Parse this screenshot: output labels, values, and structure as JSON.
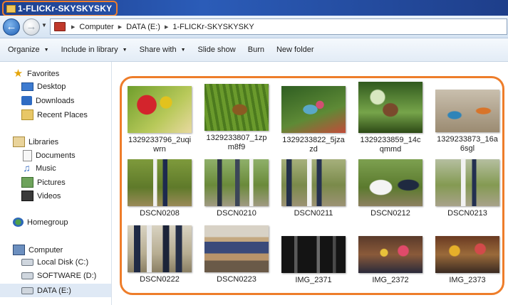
{
  "window": {
    "title": "1-FLICKr-SKYSKYSKY",
    "accent_color": "#ee7d2a"
  },
  "address": {
    "segments": [
      "Computer",
      "DATA (E:)",
      "1-FLICKr-SKYSKYSKY"
    ]
  },
  "toolbar": {
    "organize": "Organize",
    "include": "Include in library",
    "share": "Share with",
    "slideshow": "Slide show",
    "burn": "Burn",
    "newfolder": "New folder"
  },
  "nav": {
    "favorites": "Favorites",
    "desktop": "Desktop",
    "downloads": "Downloads",
    "recent": "Recent Places",
    "libraries": "Libraries",
    "documents": "Documents",
    "music": "Music",
    "pictures": "Pictures",
    "videos": "Videos",
    "homegroup": "Homegroup",
    "computer": "Computer",
    "local": "Local Disk (C:)",
    "software": "SOFTWARE (D:)",
    "data": "DATA (E:)"
  },
  "files": [
    {
      "name": "1329233796_2uqiwrn"
    },
    {
      "name": "1329233807_1zpm8f9"
    },
    {
      "name": "1329233822_5jzazd"
    },
    {
      "name": "1329233859_14cqmmd"
    },
    {
      "name": "1329233873_16a6sgl"
    },
    {
      "name": "DSCN0208"
    },
    {
      "name": "DSCN0210"
    },
    {
      "name": "DSCN0211"
    },
    {
      "name": "DSCN0212"
    },
    {
      "name": "DSCN0213"
    },
    {
      "name": "DSCN0222"
    },
    {
      "name": "DSCN0223"
    },
    {
      "name": "IMG_2371"
    },
    {
      "name": "IMG_2372"
    },
    {
      "name": "IMG_2373"
    }
  ]
}
